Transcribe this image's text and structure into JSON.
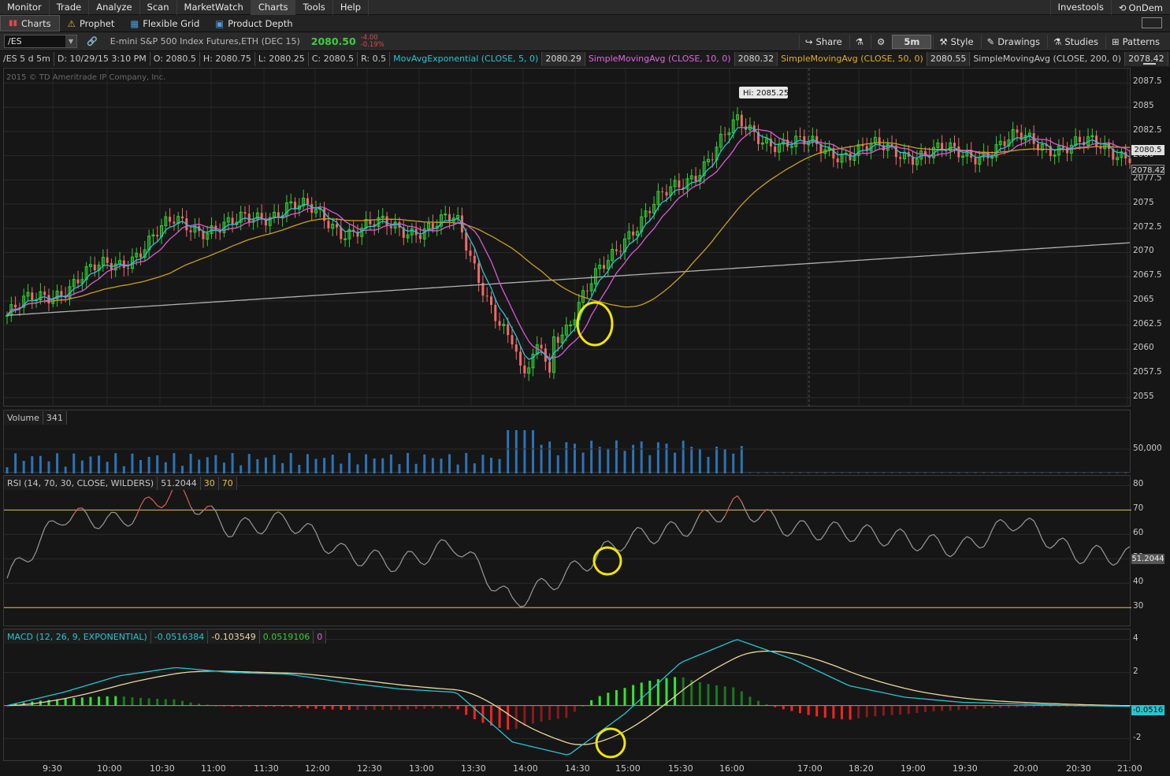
{
  "menu": [
    "Monitor",
    "Trade",
    "Analyze",
    "Scan",
    "MarketWatch",
    "Charts",
    "Tools",
    "Help"
  ],
  "menu_right": [
    "Investools",
    "OnDem"
  ],
  "subtabs": [
    "Charts",
    "Prophet",
    "Flexible Grid",
    "Product Depth"
  ],
  "symbol": "/ES",
  "description": "E-mini S&P 500 Index Futures,ETH (DEC 15)",
  "last_price": "2080.50",
  "net_change": "-4.00",
  "pct_change": "-0.19%",
  "toolbar": {
    "share": "Share",
    "timeframe": "5m",
    "style": "Style",
    "drawings": "Drawings",
    "studies": "Studies",
    "patterns": "Patterns"
  },
  "info": {
    "period": "/ES 5 d 5m",
    "date": "D: 10/29/15 3:10 PM",
    "open": "O: 2080.5",
    "high": "H: 2080.75",
    "low": "L: 2080.25",
    "close": "C: 2080.5",
    "range": "R: 0.5",
    "ema5_label": "MovAvgExponential (CLOSE, 5, 0)",
    "ema5_val": "2080.29",
    "sma10_label": "SimpleMovingAvg (CLOSE, 10, 0)",
    "sma10_val": "2080.32",
    "sma50_label": "SimpleMovingAvg (CLOSE, 50, 0)",
    "sma50_val": "2080.55",
    "sma200_label": "SimpleMovingAvg (CLOSE, 200, 0)",
    "sma200_val": "2078.42"
  },
  "copyright": "2015 © TD Ameritrade IP Company, Inc.",
  "hi_label": "Hi: 2085.25",
  "price_axis": [
    "2087.5",
    "2085",
    "2082.5",
    "2080",
    "2077.5",
    "2075",
    "2072.5",
    "2070",
    "2067.5",
    "2065",
    "2062.5",
    "2060",
    "2057.5",
    "2055"
  ],
  "price_markers": {
    "last": "2080.5",
    "sma200": "2078.42"
  },
  "volume": {
    "label": "Volume",
    "value": "341",
    "axis": "50,000"
  },
  "rsi": {
    "label": "RSI (14, 70, 30, CLOSE, WILDERS)",
    "value": "51.2044",
    "ob": "30",
    "os": "70",
    "axis": [
      "80",
      "70",
      "60",
      "50",
      "40",
      "30"
    ],
    "marker": "51.2044"
  },
  "macd": {
    "label": "MACD (12, 26, 9, EXPONENTIAL)",
    "v1": "-0.0516384",
    "v2": "-0.103549",
    "v3": "0.0519106",
    "v4": "0",
    "axis": [
      "4",
      "2",
      "-2"
    ],
    "marker": "-0.0516"
  },
  "time_axis": [
    "9:30",
    "10:00",
    "10:30",
    "11:00",
    "11:30",
    "12:00",
    "12:30",
    "13:00",
    "13:30",
    "14:00",
    "14:30",
    "15:00",
    "15:30",
    "16:00",
    "17:00",
    "18:20",
    "19:00",
    "19:30",
    "20:00",
    "20:30",
    "21:00"
  ],
  "colors": {
    "up": "#2fd12f",
    "down": "#f06a6a",
    "ema5": "#27c5d3",
    "sma10": "#d75bd7",
    "sma50": "#c8a020",
    "sma200": "#b0b0b0",
    "highlight": "#f2e600"
  },
  "chart_data": {
    "type": "line",
    "title": "",
    "x": [
      "9:30",
      "10:00",
      "10:30",
      "11:00",
      "11:30",
      "12:00",
      "12:30",
      "13:00",
      "13:30",
      "14:00",
      "14:30",
      "15:00",
      "15:30",
      "16:00",
      "17:00",
      "18:20",
      "19:00",
      "19:30",
      "20:00",
      "20:30",
      "21:00"
    ],
    "series": [
      {
        "name": "close",
        "values": [
          2063.5,
          2066.5,
          2069,
          2073,
          2072.5,
          2075,
          2072.5,
          2072.5,
          2073,
          2060,
          2062.5,
          2072,
          2077,
          2083,
          2081,
          2080.5,
          2080.5,
          2080,
          2081.5,
          2081,
          2080.5
        ]
      },
      {
        "name": "rsi",
        "values": [
          42,
          68,
          65,
          78,
          62,
          66,
          52,
          48,
          56,
          32,
          44,
          58,
          62,
          72,
          62,
          61,
          58,
          54,
          66,
          52,
          51
        ]
      },
      {
        "name": "macd",
        "values": [
          0,
          0.8,
          1.8,
          2.3,
          2.0,
          1.9,
          1.4,
          1.0,
          0.8,
          -2.2,
          -3.0,
          -0.5,
          2.6,
          4.0,
          2.8,
          1.2,
          0.5,
          0.2,
          0.1,
          0.0,
          -0.05
        ]
      }
    ],
    "ylim": [
      2055,
      2087.5
    ]
  }
}
